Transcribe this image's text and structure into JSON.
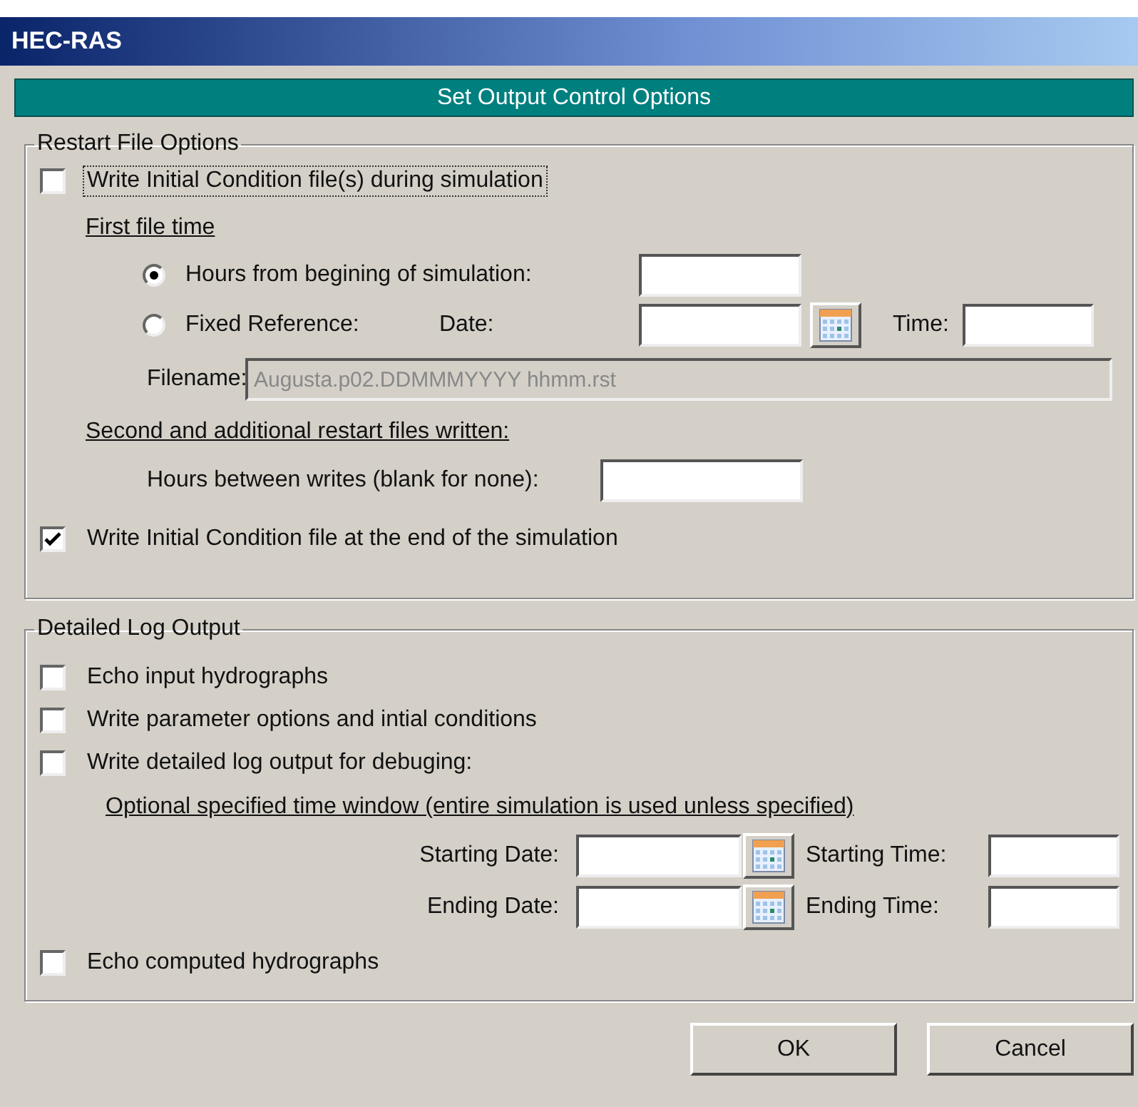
{
  "window": {
    "title": "HEC-RAS"
  },
  "banner": "Set Output Control Options",
  "restart": {
    "legend": "Restart File Options",
    "write_during": {
      "label": "Write Initial Condition file(s) during simulation",
      "checked": false,
      "focused": true
    },
    "first_time_heading": "First file time",
    "hours_option": {
      "label": "Hours from begining of simulation:",
      "selected": true
    },
    "fixed_option": {
      "label": "Fixed Reference:",
      "selected": false
    },
    "date_label": "Date:",
    "time_label": "Time:",
    "filename": {
      "label": "Filename:",
      "value": "Augusta.p02.DDMMMYYYY hhmm.rst",
      "disabled": true
    },
    "second_heading": "Second and additional restart files written:",
    "hours_between": {
      "label": "Hours between writes (blank for none):"
    },
    "write_end": {
      "label": "Write Initial Condition file at the end of the simulation",
      "checked": true,
      "focused": false
    }
  },
  "log": {
    "legend": "Detailed Log Output",
    "options": [
      {
        "label": "Echo input hydrographs",
        "checked": false
      },
      {
        "label": "Write parameter options and intial conditions",
        "checked": false
      },
      {
        "label": "Write detailed log output for debuging:",
        "checked": false
      }
    ],
    "window_heading": "Optional specified time window (entire simulation is used unless specified)",
    "time_rows": [
      {
        "date_label": "Starting Date:",
        "time_label": "Starting Time:"
      },
      {
        "date_label": "Ending Date:",
        "time_label": "Ending Time:"
      }
    ],
    "last_option": {
      "label": "Echo computed hydrographs",
      "checked": false
    }
  },
  "buttons": [
    "OK",
    "Cancel"
  ]
}
